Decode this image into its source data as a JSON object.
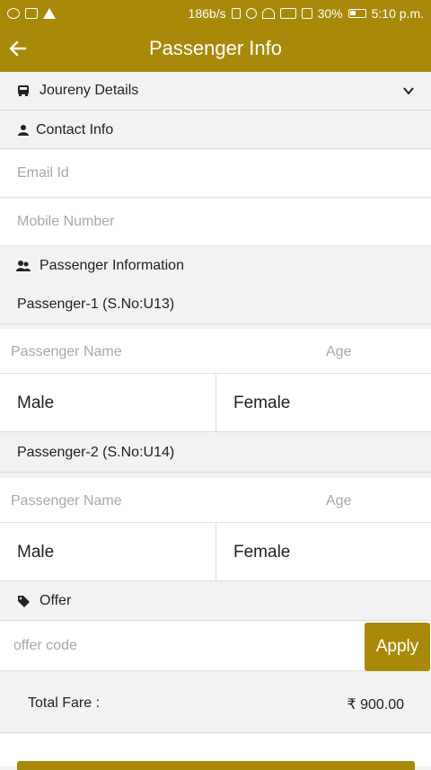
{
  "status_bar": {
    "speed": "186b/s",
    "battery": "30%",
    "time": "5:10 p.m."
  },
  "app_bar": {
    "title": "Passenger Info"
  },
  "sections": {
    "journey": "Joureny Details",
    "contact": "Contact Info",
    "passenger_info": "Passenger Information",
    "offer": "Offer"
  },
  "contact": {
    "email_placeholder": "Email Id",
    "mobile_placeholder": "Mobile Number"
  },
  "passengers": [
    {
      "label": "Passenger-1 (S.No:U13)",
      "name_placeholder": "Passenger Name",
      "age_placeholder": "Age",
      "male": "Male",
      "female": "Female"
    },
    {
      "label": "Passenger-2 (S.No:U14)",
      "name_placeholder": "Passenger Name",
      "age_placeholder": "Age",
      "male": "Male",
      "female": "Female"
    }
  ],
  "offer": {
    "placeholder": "offer code",
    "apply_label": "Apply"
  },
  "fare": {
    "label": "Total Fare :",
    "value": "₹ 900.00"
  },
  "colors": {
    "brand": "#a8890a",
    "background": "#f2f2f2"
  }
}
